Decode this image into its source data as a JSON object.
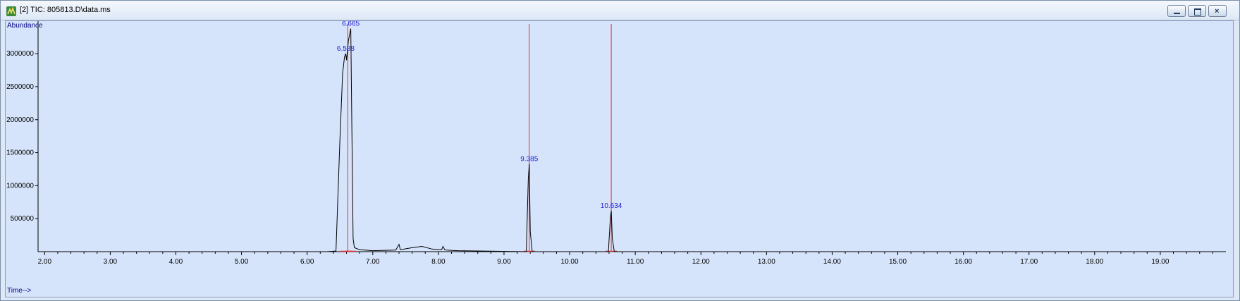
{
  "window": {
    "title": "[2] TIC: 805813.D\\data.ms",
    "icons": [
      "app-chromatogram-icon",
      "minimize-icon",
      "restore-icon",
      "close-icon"
    ]
  },
  "colors": {
    "plot_bg": "#d6e4fb",
    "trace": "#000000",
    "peak_marker": "#e03030",
    "label_blue": "#2020d0",
    "axis_title": "#000080"
  },
  "chart_data": {
    "type": "line",
    "title": "",
    "ylabel": "Abundance",
    "xlabel": "Time-->",
    "xlim": [
      1.9,
      20.0
    ],
    "ylim": [
      0,
      3450000
    ],
    "x_ticks": [
      "2.00",
      "3.00",
      "4.00",
      "5.00",
      "6.00",
      "7.00",
      "8.00",
      "9.00",
      "10.00",
      "11.00",
      "12.00",
      "13.00",
      "14.00",
      "15.00",
      "16.00",
      "17.00",
      "18.00",
      "19.00"
    ],
    "x_tick_values": [
      2,
      3,
      4,
      5,
      6,
      7,
      8,
      9,
      10,
      11,
      12,
      13,
      14,
      15,
      16,
      17,
      18,
      19
    ],
    "y_ticks": [
      "500000",
      "1000000",
      "1500000",
      "2000000",
      "2500000",
      "3000000"
    ],
    "y_tick_values": [
      500000,
      1000000,
      1500000,
      2000000,
      2500000,
      3000000
    ],
    "grid": false,
    "series": [
      {
        "x": [
          1.9,
          6.3,
          6.44,
          6.5,
          6.54,
          6.57,
          6.588,
          6.6,
          6.63,
          6.665,
          6.68,
          6.7,
          6.72,
          6.8,
          7.0,
          7.35,
          7.4,
          7.42,
          7.45,
          7.6,
          7.75,
          7.9,
          8.05,
          8.07,
          8.1,
          8.3,
          9.34,
          9.37,
          9.385,
          9.4,
          9.43,
          10.59,
          10.62,
          10.634,
          10.65,
          10.68,
          20.0
        ],
        "y": [
          0,
          0,
          10000,
          1700000,
          2700000,
          2950000,
          3000000,
          2900000,
          3200000,
          3380000,
          2000000,
          200000,
          60000,
          30000,
          15000,
          25000,
          110000,
          30000,
          35000,
          60000,
          80000,
          40000,
          30000,
          80000,
          25000,
          15000,
          0,
          1100000,
          1330000,
          300000,
          0,
          0,
          500000,
          620000,
          200000,
          0,
          0
        ]
      }
    ],
    "peaks": [
      {
        "label": "6.588",
        "x": 6.588,
        "y": 3000000
      },
      {
        "label": "6.665",
        "x": 6.665,
        "y": 3380000
      },
      {
        "label": "9.385",
        "x": 9.385,
        "y": 1330000
      },
      {
        "label": "10.634",
        "x": 10.634,
        "y": 620000
      }
    ],
    "integration_bounds": [
      6.62,
      9.385,
      10.634
    ]
  }
}
